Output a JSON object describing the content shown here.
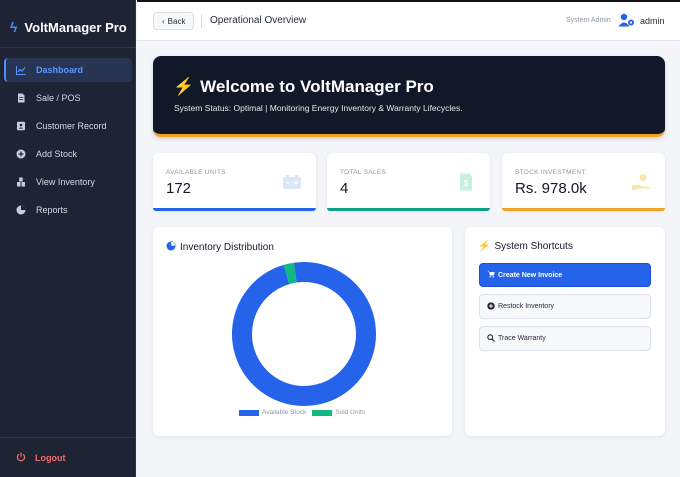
{
  "app": {
    "name": "VoltManager Pro"
  },
  "sidebar": {
    "items": [
      {
        "label": "Dashboard",
        "icon": "chart-line-icon",
        "active": true
      },
      {
        "label": "Sale / POS",
        "icon": "file-invoice-icon",
        "active": false
      },
      {
        "label": "Customer Record",
        "icon": "address-card-icon",
        "active": false
      },
      {
        "label": "Add Stock",
        "icon": "plus-circle-icon",
        "active": false
      },
      {
        "label": "View Inventory",
        "icon": "warehouse-icon",
        "active": false
      },
      {
        "label": "Reports",
        "icon": "pie-chart-icon",
        "active": false
      }
    ],
    "logout_label": "Logout"
  },
  "topbar": {
    "back_label": "Back",
    "page_title": "Operational Overview",
    "user_role": "System Admin",
    "user_name": "admin"
  },
  "hero": {
    "title": "Welcome to VoltManager Pro",
    "subtitle": "System Status: Optimal | Monitoring Energy Inventory & Warranty Lifecycles."
  },
  "stats": [
    {
      "label": "AVAILABLE UNITS",
      "value": "172",
      "icon": "battery-icon",
      "color": "#2563eb"
    },
    {
      "label": "TOTAL SALES",
      "value": "4",
      "icon": "receipt-icon",
      "color": "#0d9f8a"
    },
    {
      "label": "STOCK INVESTMENT",
      "value": "Rs. 978.0k",
      "icon": "money-hand-icon",
      "color": "#f1a325"
    }
  ],
  "distribution": {
    "title": "Inventory Distribution",
    "legend": {
      "available": "Available Stock",
      "sold": "Sold Units"
    }
  },
  "chart_data": {
    "type": "pie",
    "categories": [
      "Available Stock",
      "Sold Units"
    ],
    "values": [
      172,
      4
    ],
    "colors": [
      "#2563eb",
      "#10b981"
    ],
    "style": "donut",
    "legend": "bottom"
  },
  "shortcuts": {
    "title": "System Shortcuts",
    "items": [
      {
        "label": "Create New Invoice",
        "icon": "cart-icon",
        "style": "primary"
      },
      {
        "label": "Restock Inventory",
        "icon": "plus-circle-icon",
        "style": "secondary"
      },
      {
        "label": "Trace Warranty",
        "icon": "search-icon",
        "style": "secondary"
      }
    ]
  }
}
